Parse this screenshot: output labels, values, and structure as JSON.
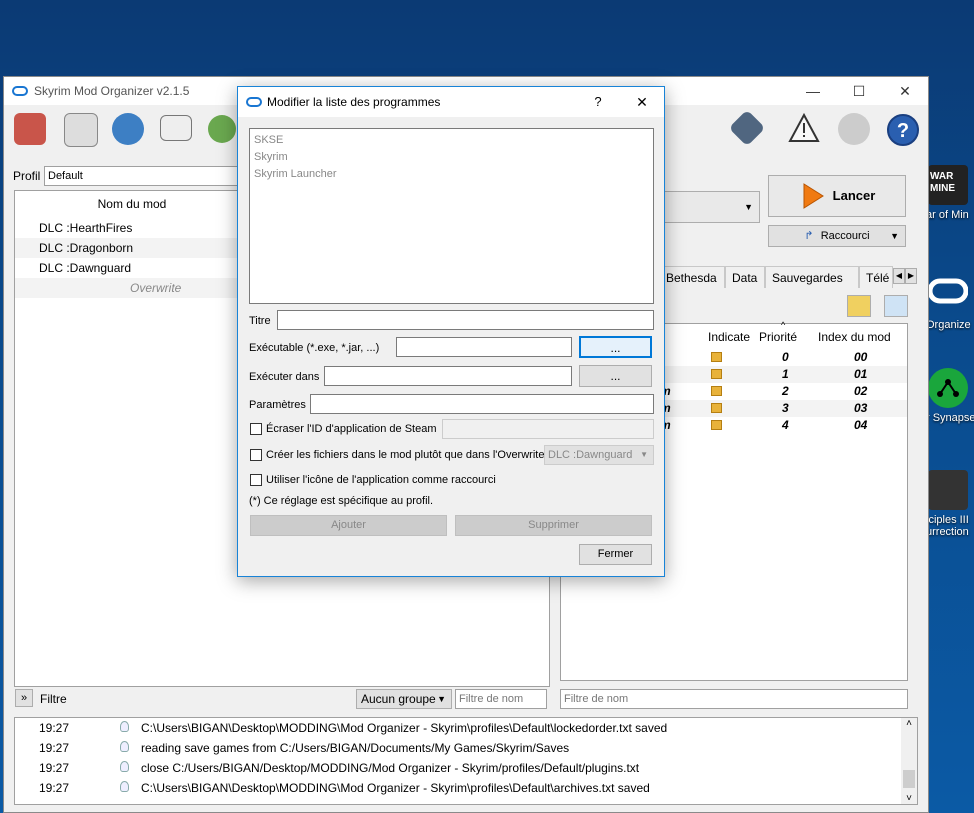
{
  "window": {
    "title": "Skyrim Mod Organizer v2.1.5"
  },
  "desktop": [
    {
      "label": "ar of Min",
      "top_text": "WAR MINE"
    },
    {
      "label": "Organize"
    },
    {
      "label": "r Synapse"
    },
    {
      "label": "iciples III",
      "label2": "urrection"
    }
  ],
  "profile": {
    "label": "Profil",
    "value": "Default"
  },
  "modlist": {
    "header": "Nom du mod",
    "rows": [
      "DLC :HearthFires",
      "DLC :Dragonborn",
      "DLC :Dawnguard"
    ],
    "overwrite": "Overwrite"
  },
  "left_bottom": {
    "filter_toggle": "»",
    "filter_label": "Filtre",
    "group_select": "Aucun groupe",
    "name_filter_placeholder": "Filtre de nom"
  },
  "right": {
    "launch": "Lancer",
    "shortcut": "Raccourci",
    "tabs": [
      "Bethesda",
      "Data",
      "Sauvegardes",
      "Télé"
    ],
    "columns": [
      "Indicate",
      "Priorité",
      "Index du mod"
    ],
    "rows": [
      {
        "name": "",
        "priority": "0",
        "index": "00"
      },
      {
        "name": "",
        "priority": "1",
        "index": "01"
      },
      {
        "name": "m",
        "priority": "2",
        "index": "02"
      },
      {
        "name": "m",
        "priority": "3",
        "index": "03"
      },
      {
        "name": "m",
        "priority": "4",
        "index": "04"
      }
    ],
    "name_filter_placeholder": "Filtre de nom"
  },
  "log": [
    {
      "time": "19:27",
      "msg": "C:\\Users\\BIGAN\\Desktop\\MODDING\\Mod Organizer - Skyrim\\profiles\\Default\\lockedorder.txt saved"
    },
    {
      "time": "19:27",
      "msg": "reading save games from C:/Users/BIGAN/Documents/My Games/Skyrim/Saves"
    },
    {
      "time": "19:27",
      "msg": "close C:/Users/BIGAN/Desktop/MODDING/Mod Organizer - Skyrim/profiles/Default/plugins.txt"
    },
    {
      "time": "19:27",
      "msg": "C:\\Users\\BIGAN\\Desktop\\MODDING\\Mod Organizer - Skyrim\\profiles\\Default\\archives.txt saved"
    }
  ],
  "dialog": {
    "title": "Modifier la liste des programmes",
    "help": "?",
    "close": "✕",
    "programs": [
      "SKSE",
      "Skyrim",
      "Skyrim Launcher"
    ],
    "title_label": "Titre",
    "exe_label": "Exécutable (*.exe, *.jar, ...)",
    "run_in_label": "Exécuter dans",
    "params_label": "Paramètres",
    "browse": "...",
    "steam_override": "Écraser l'ID d'application de Steam",
    "create_files": "Créer les fichiers dans le mod plutôt que dans l'Overwrite",
    "create_files_mod": "DLC :Dawnguard",
    "use_icon": "Utiliser l'icône de l'application comme raccourci",
    "note": "(*) Ce réglage est spécifique au profil.",
    "add": "Ajouter",
    "remove": "Supprimer",
    "close_button": "Fermer"
  }
}
